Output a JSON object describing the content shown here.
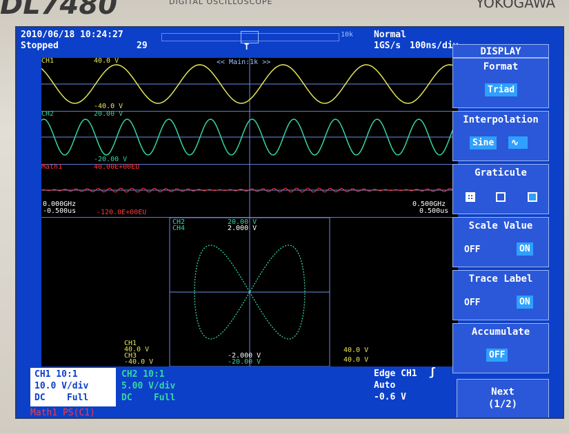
{
  "device": {
    "brand": "DL7480",
    "subtitle": "DIGITAL OSCILLOSCOPE",
    "maker": "YOKOGAWA"
  },
  "status": {
    "datetime": "2010/06/18 10:24:27",
    "state": "Stopped",
    "count": "29",
    "record_length": "10k",
    "mode": "Normal",
    "sample_rate": "1GS/s",
    "timebase": "100ns/div"
  },
  "main_label": "<< Main:1k >>",
  "channels": [
    {
      "name": "CH1",
      "top": "40.0 V",
      "bottom": "-40.0 V"
    },
    {
      "name": "CH2",
      "top": "20.00 V",
      "bottom": "-20.00 V"
    },
    {
      "name": "Math1",
      "top": "40.00E+00EU",
      "bottom": "-120.0E+00EU",
      "left_freq": "0.000GHz",
      "left_time": "-0.500us",
      "right_freq": "0.500GHz",
      "right_time": "0.500us"
    }
  ],
  "xy": {
    "x_label": "CH2",
    "x_label2": "CH4",
    "top": "20.00 V",
    "top2": "2.000 V",
    "bottom": "-2.000 V",
    "bottom2": "-20.00 V",
    "left_ch": "CH1",
    "left_top": "40.0 V",
    "left_ch2": "CH3",
    "left_bottom": "-40.0 V",
    "right_top": "40.0 V",
    "right_bottom": "40.0 V"
  },
  "bottom_bar": {
    "ch1_line1": "CH1 10:1",
    "ch1_line2": "10.0 V/div",
    "ch1_line3": "DC    Full",
    "ch2_line1": "CH2 10:1",
    "ch2_line2": "5.00 V/div",
    "ch2_line3": "DC    Full",
    "math_line": "Math1 PS(C1)",
    "trigger_line1": "Edge CH1",
    "trigger_line2": "Auto",
    "trigger_line3": "-0.6 V"
  },
  "menu": {
    "title": "DISPLAY",
    "format_label": "Format",
    "format_value": "Triad",
    "interp_label": "Interpolation",
    "interp_value": "Sine",
    "graticule_label": "Graticule",
    "scale_label": "Scale Value",
    "scale_off": "OFF",
    "scale_on": "ON",
    "trace_label": "Trace Label",
    "trace_off": "OFF",
    "trace_on": "ON",
    "accum_label": "Accumulate",
    "accum_value": "OFF",
    "next_label": "Next",
    "next_page": "(1/2)"
  },
  "colors": {
    "ch1": "#e6e65a",
    "ch2": "#35d6a6",
    "math": "#ff3a3a",
    "screen_bg": "#0c40c8"
  }
}
